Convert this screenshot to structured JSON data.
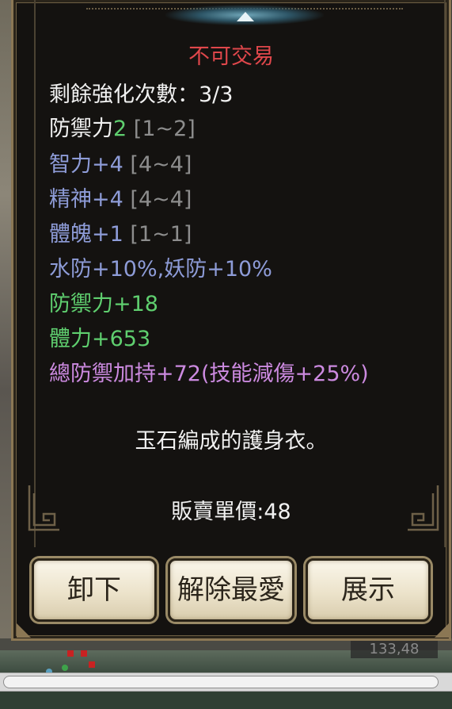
{
  "background": {
    "position_readout": "133,48"
  },
  "tooltip": {
    "trade_status": "不可交易",
    "enhance_label": "剩餘強化次數：",
    "enhance_value": "3/3",
    "stats": [
      {
        "name": "防禦力",
        "value": "2",
        "range": "[1~2]"
      },
      {
        "name": "智力+4",
        "range": "[4~4]"
      },
      {
        "name": "精神+4",
        "range": "[4~4]"
      },
      {
        "name": "體魄+1",
        "range": "[1~1]"
      }
    ],
    "resist_line": "水防+10%,妖防+10%",
    "bonus_lines": [
      "防禦力+18",
      "體力+653"
    ],
    "set_bonus": "總防禦加持+72(技能減傷+25%)",
    "description": "玉石編成的護身衣。",
    "sell_price_label": "販賣單價:",
    "sell_price": "48"
  },
  "buttons": {
    "unequip": "卸下",
    "unfavorite": "解除最愛",
    "show": "展示"
  },
  "colors": {
    "trade_status": "#e0474b",
    "stat_base": "#8e9cd8",
    "stat_bonus": "#5fcf6f",
    "set_bonus": "#cc8ae0",
    "range": "#8d8d8d",
    "panel_border": "#8b7754"
  }
}
